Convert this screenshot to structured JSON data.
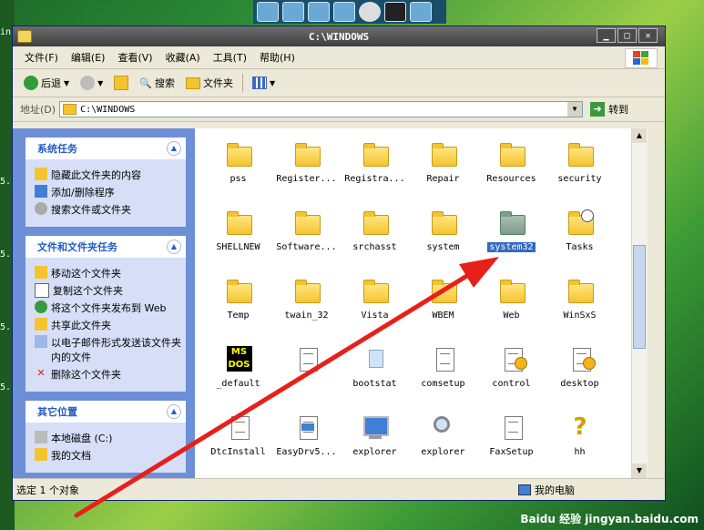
{
  "window": {
    "title": "C:\\WINDOWS"
  },
  "menu": [
    "文件(F)",
    "编辑(E)",
    "查看(V)",
    "收藏(A)",
    "工具(T)",
    "帮助(H)"
  ],
  "toolbar": {
    "back": "后退",
    "search": "搜索",
    "folders": "文件夹"
  },
  "address": {
    "label": "地址(D)",
    "value": "C:\\WINDOWS",
    "go": "转到"
  },
  "left_pane": {
    "system_tasks": {
      "title": "系统任务",
      "items": [
        "隐藏此文件夹的内容",
        "添加/删除程序",
        "搜索文件或文件夹"
      ]
    },
    "file_tasks": {
      "title": "文件和文件夹任务",
      "items": [
        "移动这个文件夹",
        "复制这个文件夹",
        "将这个文件夹发布到 Web",
        "共享此文件夹",
        "以电子邮件形式发送该文件夹内的文件",
        "删除这个文件夹"
      ]
    },
    "other_places": {
      "title": "其它位置",
      "items": [
        "本地磁盘 (C:)",
        "我的文档"
      ]
    }
  },
  "files": [
    {
      "name": "pss",
      "type": "folder"
    },
    {
      "name": "Register...",
      "type": "folder"
    },
    {
      "name": "Registra...",
      "type": "folder"
    },
    {
      "name": "Repair",
      "type": "folder"
    },
    {
      "name": "Resources",
      "type": "folder"
    },
    {
      "name": "security",
      "type": "folder"
    },
    {
      "name": "SHELLNEW",
      "type": "folder"
    },
    {
      "name": "Software...",
      "type": "folder"
    },
    {
      "name": "srchasst",
      "type": "folder"
    },
    {
      "name": "system",
      "type": "folder"
    },
    {
      "name": "system32",
      "type": "folder-selected"
    },
    {
      "name": "Tasks",
      "type": "folder-tasks"
    },
    {
      "name": "Temp",
      "type": "folder"
    },
    {
      "name": "twain_32",
      "type": "folder"
    },
    {
      "name": "Vista",
      "type": "folder"
    },
    {
      "name": "WBEM",
      "type": "folder"
    },
    {
      "name": "Web",
      "type": "folder"
    },
    {
      "name": "WinSxS",
      "type": "folder"
    },
    {
      "name": "_default",
      "type": "msdos"
    },
    {
      "name": "",
      "type": "doc"
    },
    {
      "name": "bootstat",
      "type": "bootstat"
    },
    {
      "name": "comsetup",
      "type": "doc"
    },
    {
      "name": "control",
      "type": "doc-gear"
    },
    {
      "name": "desktop",
      "type": "doc-gear"
    },
    {
      "name": "DtcInstall",
      "type": "doc"
    },
    {
      "name": "EasyDrv5...",
      "type": "doc-window"
    },
    {
      "name": "explorer",
      "type": "computer"
    },
    {
      "name": "explorer",
      "type": "search"
    },
    {
      "name": "FaxSetup",
      "type": "doc"
    },
    {
      "name": "hh",
      "type": "help"
    }
  ],
  "status": {
    "left": "选定 1 个对象",
    "right": "我的电脑"
  },
  "desktop_fragments": [
    "in'",
    "5.",
    "5.",
    "5.",
    "5."
  ],
  "watermark": "Baidu 经验 jingyan.baidu.com",
  "colors": {
    "annotation_arrow": "#e8201a",
    "selection": "#316ac5",
    "task_pane": "#6d8fd8"
  }
}
